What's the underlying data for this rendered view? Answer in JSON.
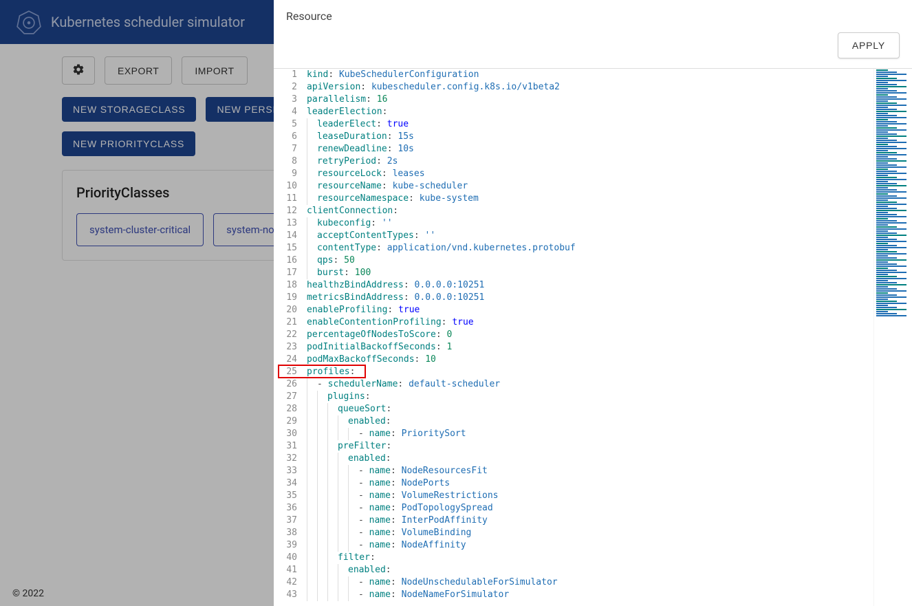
{
  "header": {
    "title": "Kubernetes scheduler simulator"
  },
  "toolbar": {
    "export_label": "EXPORT",
    "import_label": "IMPORT"
  },
  "actions": {
    "new_storageclass": "NEW STORAGECLASS",
    "new_persistentvolume": "NEW PERSI",
    "new_priorityclass": "NEW PRIORITYCLASS"
  },
  "section": {
    "title": "PriorityClasses",
    "chips": [
      "system-cluster-critical",
      "system-no"
    ]
  },
  "footer": {
    "copyright": "© 2022"
  },
  "modal": {
    "title": "Resource",
    "apply_label": "APPLY"
  },
  "code": {
    "lines": [
      {
        "n": 1,
        "i": 0,
        "t": [
          [
            "key",
            "kind"
          ],
          [
            "p",
            ": "
          ],
          [
            "str",
            "KubeSchedulerConfiguration"
          ]
        ]
      },
      {
        "n": 2,
        "i": 0,
        "t": [
          [
            "key",
            "apiVersion"
          ],
          [
            "p",
            ": "
          ],
          [
            "str",
            "kubescheduler.config.k8s.io/v1beta2"
          ]
        ]
      },
      {
        "n": 3,
        "i": 0,
        "t": [
          [
            "key",
            "parallelism"
          ],
          [
            "p",
            ": "
          ],
          [
            "num",
            "16"
          ]
        ]
      },
      {
        "n": 4,
        "i": 0,
        "t": [
          [
            "key",
            "leaderElection"
          ],
          [
            "p",
            ":"
          ]
        ]
      },
      {
        "n": 5,
        "i": 1,
        "t": [
          [
            "key",
            "leaderElect"
          ],
          [
            "p",
            ": "
          ],
          [
            "bool",
            "true"
          ]
        ]
      },
      {
        "n": 6,
        "i": 1,
        "t": [
          [
            "key",
            "leaseDuration"
          ],
          [
            "p",
            ": "
          ],
          [
            "str",
            "15s"
          ]
        ]
      },
      {
        "n": 7,
        "i": 1,
        "t": [
          [
            "key",
            "renewDeadline"
          ],
          [
            "p",
            ": "
          ],
          [
            "str",
            "10s"
          ]
        ]
      },
      {
        "n": 8,
        "i": 1,
        "t": [
          [
            "key",
            "retryPeriod"
          ],
          [
            "p",
            ": "
          ],
          [
            "str",
            "2s"
          ]
        ]
      },
      {
        "n": 9,
        "i": 1,
        "t": [
          [
            "key",
            "resourceLock"
          ],
          [
            "p",
            ": "
          ],
          [
            "str",
            "leases"
          ]
        ]
      },
      {
        "n": 10,
        "i": 1,
        "t": [
          [
            "key",
            "resourceName"
          ],
          [
            "p",
            ": "
          ],
          [
            "str",
            "kube-scheduler"
          ]
        ]
      },
      {
        "n": 11,
        "i": 1,
        "t": [
          [
            "key",
            "resourceNamespace"
          ],
          [
            "p",
            ": "
          ],
          [
            "str",
            "kube-system"
          ]
        ]
      },
      {
        "n": 12,
        "i": 0,
        "t": [
          [
            "key",
            "clientConnection"
          ],
          [
            "p",
            ":"
          ]
        ]
      },
      {
        "n": 13,
        "i": 1,
        "t": [
          [
            "key",
            "kubeconfig"
          ],
          [
            "p",
            ": "
          ],
          [
            "str",
            "''"
          ]
        ]
      },
      {
        "n": 14,
        "i": 1,
        "t": [
          [
            "key",
            "acceptContentTypes"
          ],
          [
            "p",
            ": "
          ],
          [
            "str",
            "''"
          ]
        ]
      },
      {
        "n": 15,
        "i": 1,
        "t": [
          [
            "key",
            "contentType"
          ],
          [
            "p",
            ": "
          ],
          [
            "str",
            "application/vnd.kubernetes.protobuf"
          ]
        ]
      },
      {
        "n": 16,
        "i": 1,
        "t": [
          [
            "key",
            "qps"
          ],
          [
            "p",
            ": "
          ],
          [
            "num",
            "50"
          ]
        ]
      },
      {
        "n": 17,
        "i": 1,
        "t": [
          [
            "key",
            "burst"
          ],
          [
            "p",
            ": "
          ],
          [
            "num",
            "100"
          ]
        ]
      },
      {
        "n": 18,
        "i": 0,
        "t": [
          [
            "key",
            "healthzBindAddress"
          ],
          [
            "p",
            ": "
          ],
          [
            "str",
            "0.0.0.0:10251"
          ]
        ]
      },
      {
        "n": 19,
        "i": 0,
        "t": [
          [
            "key",
            "metricsBindAddress"
          ],
          [
            "p",
            ": "
          ],
          [
            "str",
            "0.0.0.0:10251"
          ]
        ]
      },
      {
        "n": 20,
        "i": 0,
        "t": [
          [
            "key",
            "enableProfiling"
          ],
          [
            "p",
            ": "
          ],
          [
            "bool",
            "true"
          ]
        ]
      },
      {
        "n": 21,
        "i": 0,
        "t": [
          [
            "key",
            "enableContentionProfiling"
          ],
          [
            "p",
            ": "
          ],
          [
            "bool",
            "true"
          ]
        ]
      },
      {
        "n": 22,
        "i": 0,
        "t": [
          [
            "key",
            "percentageOfNodesToScore"
          ],
          [
            "p",
            ": "
          ],
          [
            "num",
            "0"
          ]
        ]
      },
      {
        "n": 23,
        "i": 0,
        "t": [
          [
            "key",
            "podInitialBackoffSeconds"
          ],
          [
            "p",
            ": "
          ],
          [
            "num",
            "1"
          ]
        ]
      },
      {
        "n": 24,
        "i": 0,
        "t": [
          [
            "key",
            "podMaxBackoffSeconds"
          ],
          [
            "p",
            ": "
          ],
          [
            "num",
            "10"
          ]
        ]
      },
      {
        "n": 25,
        "i": 0,
        "t": [
          [
            "key",
            "profiles"
          ],
          [
            "p",
            ":"
          ]
        ]
      },
      {
        "n": 26,
        "i": 1,
        "t": [
          [
            "dash",
            "- "
          ],
          [
            "key",
            "schedulerName"
          ],
          [
            "p",
            ": "
          ],
          [
            "str",
            "default-scheduler"
          ]
        ]
      },
      {
        "n": 27,
        "i": 2,
        "t": [
          [
            "key",
            "plugins"
          ],
          [
            "p",
            ":"
          ]
        ]
      },
      {
        "n": 28,
        "i": 3,
        "t": [
          [
            "key",
            "queueSort"
          ],
          [
            "p",
            ":"
          ]
        ]
      },
      {
        "n": 29,
        "i": 4,
        "t": [
          [
            "key",
            "enabled"
          ],
          [
            "p",
            ":"
          ]
        ]
      },
      {
        "n": 30,
        "i": 5,
        "t": [
          [
            "dash",
            "- "
          ],
          [
            "key",
            "name"
          ],
          [
            "p",
            ": "
          ],
          [
            "str",
            "PrioritySort"
          ]
        ]
      },
      {
        "n": 31,
        "i": 3,
        "t": [
          [
            "key",
            "preFilter"
          ],
          [
            "p",
            ":"
          ]
        ]
      },
      {
        "n": 32,
        "i": 4,
        "t": [
          [
            "key",
            "enabled"
          ],
          [
            "p",
            ":"
          ]
        ]
      },
      {
        "n": 33,
        "i": 5,
        "t": [
          [
            "dash",
            "- "
          ],
          [
            "key",
            "name"
          ],
          [
            "p",
            ": "
          ],
          [
            "str",
            "NodeResourcesFit"
          ]
        ]
      },
      {
        "n": 34,
        "i": 5,
        "t": [
          [
            "dash",
            "- "
          ],
          [
            "key",
            "name"
          ],
          [
            "p",
            ": "
          ],
          [
            "str",
            "NodePorts"
          ]
        ]
      },
      {
        "n": 35,
        "i": 5,
        "t": [
          [
            "dash",
            "- "
          ],
          [
            "key",
            "name"
          ],
          [
            "p",
            ": "
          ],
          [
            "str",
            "VolumeRestrictions"
          ]
        ]
      },
      {
        "n": 36,
        "i": 5,
        "t": [
          [
            "dash",
            "- "
          ],
          [
            "key",
            "name"
          ],
          [
            "p",
            ": "
          ],
          [
            "str",
            "PodTopologySpread"
          ]
        ]
      },
      {
        "n": 37,
        "i": 5,
        "t": [
          [
            "dash",
            "- "
          ],
          [
            "key",
            "name"
          ],
          [
            "p",
            ": "
          ],
          [
            "str",
            "InterPodAffinity"
          ]
        ]
      },
      {
        "n": 38,
        "i": 5,
        "t": [
          [
            "dash",
            "- "
          ],
          [
            "key",
            "name"
          ],
          [
            "p",
            ": "
          ],
          [
            "str",
            "VolumeBinding"
          ]
        ]
      },
      {
        "n": 39,
        "i": 5,
        "t": [
          [
            "dash",
            "- "
          ],
          [
            "key",
            "name"
          ],
          [
            "p",
            ": "
          ],
          [
            "str",
            "NodeAffinity"
          ]
        ]
      },
      {
        "n": 40,
        "i": 3,
        "t": [
          [
            "key",
            "filter"
          ],
          [
            "p",
            ":"
          ]
        ]
      },
      {
        "n": 41,
        "i": 4,
        "t": [
          [
            "key",
            "enabled"
          ],
          [
            "p",
            ":"
          ]
        ]
      },
      {
        "n": 42,
        "i": 5,
        "t": [
          [
            "dash",
            "- "
          ],
          [
            "key",
            "name"
          ],
          [
            "p",
            ": "
          ],
          [
            "str",
            "NodeUnschedulableForSimulator"
          ]
        ]
      },
      {
        "n": 43,
        "i": 5,
        "t": [
          [
            "dash",
            "- "
          ],
          [
            "key",
            "name"
          ],
          [
            "p",
            ": "
          ],
          [
            "str",
            "NodeNameForSimulator"
          ]
        ]
      }
    ],
    "highlight_line": 25
  }
}
